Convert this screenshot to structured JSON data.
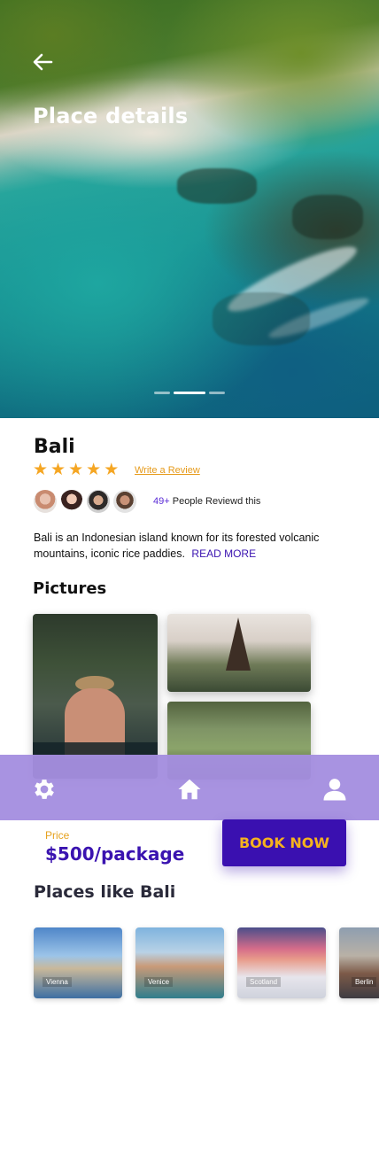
{
  "header": {
    "title": "Place details"
  },
  "carousel": {
    "slides": 3,
    "active_index": 1
  },
  "place": {
    "name": "Bali",
    "rating": 5,
    "write_review_label": "Write a Review",
    "reviewers_count": "49+",
    "reviewers_text": "People Reviewd this",
    "description": "Bali is an Indonesian island known for its forested volcanic mountains, iconic rice paddies.",
    "read_more_label": "READ MORE"
  },
  "pictures": {
    "title": "Pictures"
  },
  "nav": {
    "items": [
      "gear-icon",
      "home-icon",
      "user-icon"
    ]
  },
  "booking": {
    "price_label": "Price",
    "price_value": "$500/package",
    "book_label": "BOOK NOW"
  },
  "similar": {
    "title": "Places like Bali",
    "places": [
      {
        "label": "Vienna"
      },
      {
        "label": "Venice"
      },
      {
        "label": "Scotland"
      },
      {
        "label": "Berlin"
      }
    ]
  },
  "colors": {
    "accent": "#3a10b0",
    "star": "#f5a623",
    "nav_bg": "#a58fe0",
    "price_label": "#e6a21f"
  }
}
